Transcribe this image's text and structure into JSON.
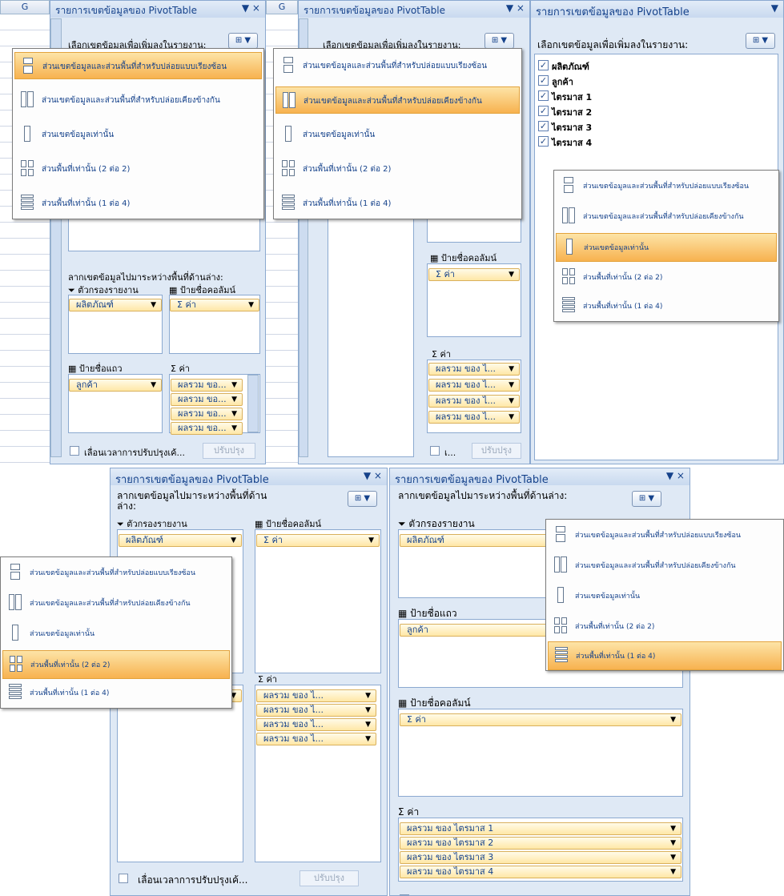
{
  "common": {
    "panel_title": "รายการเขตข้อมูลของ PivotTable",
    "choose_fields_label": "เลือกเขตข้อมูลเพื่อเพิ่มลงในรายงาน:",
    "drag_label": "ลากเขตข้อมูลไปมาระหว่างพื้นที่ด้านล่าง:",
    "report_filter_label": "ตัวกรองรายงาน",
    "column_labels_label": "ป้ายชื่อคอลัมน์",
    "row_labels_label": "ป้ายชื่อแถว",
    "values_label": "ค่า",
    "defer_update_label": "เลื่อนเวลาการปรับปรุงเค้...",
    "update_button": "ปรับปรุง",
    "column_header": "G",
    "sigma": "Σ",
    "close_glyph": "×",
    "dropdown_glyph": "▼"
  },
  "layout_menu": [
    "ส่วนเขตข้อมูลและส่วนพื้นที่สำหรับปล่อยแบบเรียงซ้อน",
    "ส่วนเขตข้อมูลและส่วนพื้นที่สำหรับปล่อยเคียงข้างกัน",
    "ส่วนเขตข้อมูลเท่านั้น",
    "ส่วนพื้นที่เท่านั้น (2 ต่อ 2)",
    "ส่วนพื้นที่เท่านั้น (1 ต่อ 4)"
  ],
  "fields": [
    "ผลิตภัณฑ์",
    "ลูกค้า",
    "ไตรมาส 1",
    "ไตรมาส 2",
    "ไตรมาส 3",
    "ไตรมาส 4"
  ],
  "pill_values": {
    "product": "ผลิตภัณฑ์",
    "customer": "ลูกค้า",
    "values": "Σ ค่า",
    "sum_short": "ผลรวม ขอ...",
    "sum_medium": "ผลรวม ของ ไ...",
    "sum_full": [
      "ผลรวม ของ ไตรมาส 1",
      "ผลรวม ของ ไตรมาส 2",
      "ผลรวม ของ ไตรมาส 3",
      "ผลรวม ของ ไตรมาส 4"
    ],
    "defer_short": "เ..."
  },
  "panels": {
    "p1_selected": 0,
    "p2_selected": 1,
    "p3_selected": 2,
    "p4_selected": 3,
    "p5_selected": 4
  },
  "colors": {
    "accent": "#15428b",
    "highlight": "#f7b24f",
    "panel_bg": "#dfe9f5"
  }
}
